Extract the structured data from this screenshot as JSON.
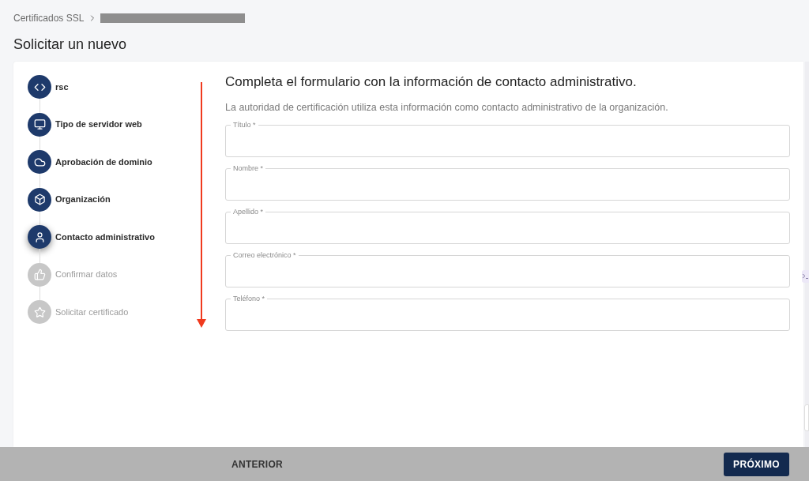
{
  "breadcrumb": {
    "parent": "Certificados SSL",
    "current_redacted": true
  },
  "page_title": "Solicitar un nuevo",
  "steps": [
    {
      "label": "rsc",
      "disabled": false,
      "selected": false
    },
    {
      "label": "Tipo de servidor web",
      "disabled": false,
      "selected": false
    },
    {
      "label": "Aprobación de dominio",
      "disabled": false,
      "selected": false
    },
    {
      "label": "Organización",
      "disabled": false,
      "selected": false
    },
    {
      "label": "Contacto administrativo",
      "disabled": false,
      "selected": true
    },
    {
      "label": "Confirmar datos",
      "disabled": true,
      "selected": false
    },
    {
      "label": "Solicitar certificado",
      "disabled": true,
      "selected": false
    }
  ],
  "form": {
    "heading": "Completa el formulario con la información de contacto administrativo.",
    "description": "La autoridad de certificación utiliza esta información como contacto administrativo de la organización.",
    "fields": [
      {
        "label": "Título *"
      },
      {
        "label": "Nombre *"
      },
      {
        "label": "Apellido *"
      },
      {
        "label": "Correo electrónico *"
      },
      {
        "label": "Teléfono *"
      }
    ]
  },
  "footer": {
    "back_button": "ANTERIOR",
    "next_button": "PRÓXIMO"
  }
}
